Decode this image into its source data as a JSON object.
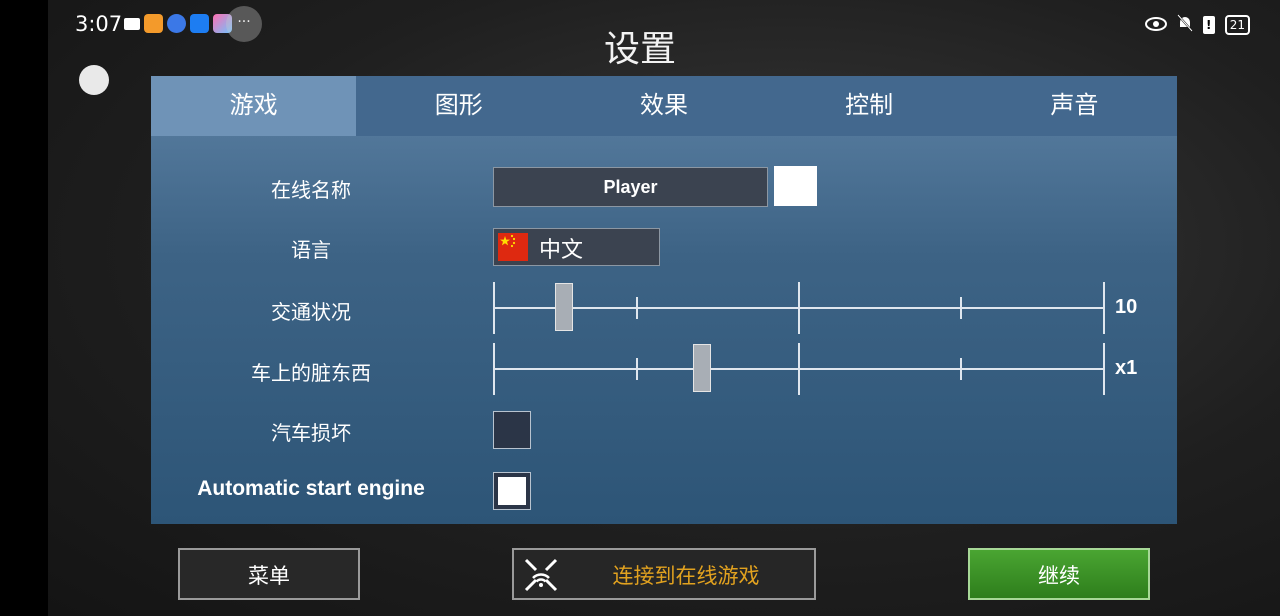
{
  "status_bar": {
    "time": "3:07",
    "battery": "21",
    "left_icons": [
      "video-icon",
      "play-icon",
      "browser-icon",
      "cloud-icon",
      "app-icon"
    ],
    "more_label": "···"
  },
  "title": "设置",
  "tabs": [
    {
      "label": "游戏",
      "active": true
    },
    {
      "label": "图形",
      "active": false
    },
    {
      "label": "效果",
      "active": false
    },
    {
      "label": "控制",
      "active": false
    },
    {
      "label": "声音",
      "active": false
    }
  ],
  "settings": {
    "online_name": {
      "label": "在线名称",
      "value": "Player"
    },
    "language": {
      "label": "语言",
      "value": "中文",
      "flag": "china-flag-icon"
    },
    "traffic": {
      "label": "交通状况",
      "value_label": "10",
      "position": 0.115
    },
    "dirt": {
      "label": "车上的脏东西",
      "value_label": "x1",
      "position": 0.34
    },
    "damage": {
      "label": "汽车损坏",
      "checked": false
    },
    "auto_start": {
      "label": "Automatic start engine",
      "checked": true
    }
  },
  "buttons": {
    "menu": "菜单",
    "online": "连接到在线游戏",
    "continue": "继续"
  },
  "colors": {
    "panel_top": "#5c81a4",
    "tab_active": "#6f93b7",
    "continue_green": "#3b9127",
    "online_text": "#e2a21f"
  }
}
